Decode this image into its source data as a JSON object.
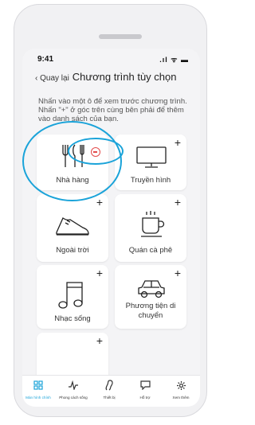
{
  "status_bar": {
    "time": "9:41",
    "signal": ".ıl ᯤ ▬"
  },
  "nav": {
    "back_label": "‹ Quay lại",
    "title": "Chương trình tùy chọn"
  },
  "description": "Nhấn vào một ô để xem trước chương trình. Nhấn \"+\" ở góc trên cùng bên phải để thêm vào danh sách của bạn.",
  "cards": [
    {
      "label": "Nhà hàng",
      "icon": "restaurant-icon",
      "action": "remove"
    },
    {
      "label": "Truyền hình",
      "icon": "tv-icon",
      "action": "add"
    },
    {
      "label": "Ngoài trời",
      "icon": "shoe-icon",
      "action": "add"
    },
    {
      "label": "Quán cà phê",
      "icon": "coffee-icon",
      "action": "add"
    },
    {
      "label": "Nhạc sống",
      "icon": "music-note-icon",
      "action": "add"
    },
    {
      "label": "Phương tiện di chuyển",
      "icon": "car-icon",
      "action": "add"
    }
  ],
  "add_symbol": "+",
  "tabs": [
    {
      "label": "Màn hình chính",
      "icon": "home-grid-icon",
      "active": true
    },
    {
      "label": "Phong cách sống",
      "icon": "lifestyle-icon",
      "active": false
    },
    {
      "label": "Thiết bị",
      "icon": "hearing-device-icon",
      "active": false
    },
    {
      "label": "Hỗ trợ",
      "icon": "chat-bubble-icon",
      "active": false
    },
    {
      "label": "Xem thêm",
      "icon": "gear-icon",
      "active": false
    }
  ],
  "colors": {
    "accent": "#1aa3d9",
    "remove": "#e34b4b"
  }
}
